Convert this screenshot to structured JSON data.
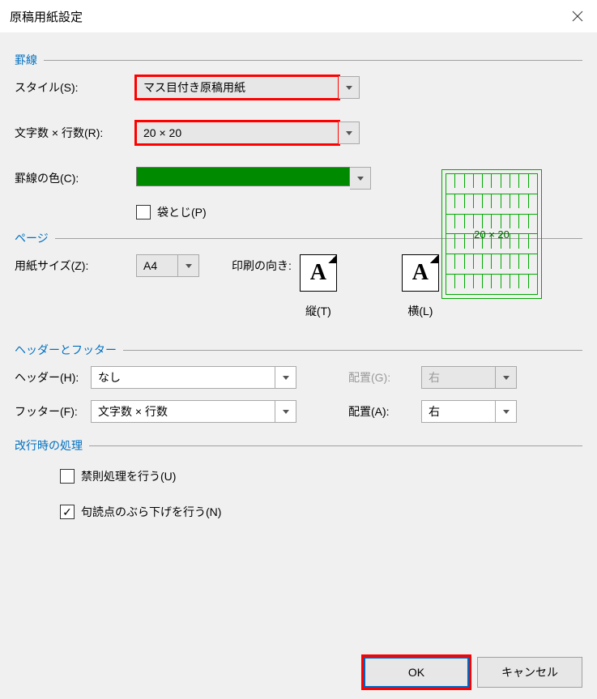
{
  "title": "原稿用紙設定",
  "sections": {
    "grid": "罫線",
    "page": "ページ",
    "hf": "ヘッダーとフッター",
    "lb": "改行時の処理"
  },
  "grid": {
    "style_label": "スタイル(S):",
    "style_value": "マス目付き原稿用紙",
    "chars_label": "文字数 × 行数(R):",
    "chars_value": "20 × 20",
    "color_label": "罫線の色(C):",
    "color_value": "#008a00",
    "book_label": "袋とじ(P)",
    "preview_text": "20 × 20"
  },
  "page": {
    "size_label": "用紙サイズ(Z):",
    "size_value": "A4",
    "orient_label": "印刷の向き:",
    "orient_portrait": "縦(T)",
    "orient_landscape": "横(L)"
  },
  "hf": {
    "header_label": "ヘッダー(H):",
    "header_value": "なし",
    "header_align_label": "配置(G):",
    "header_align_value": "右",
    "footer_label": "フッター(F):",
    "footer_value": "文字数 × 行数",
    "footer_align_label": "配置(A):",
    "footer_align_value": "右"
  },
  "lb": {
    "kinsoku": "禁則処理を行う(U)",
    "burasage": "句読点のぶら下げを行う(N)"
  },
  "buttons": {
    "ok": "OK",
    "cancel": "キャンセル"
  }
}
